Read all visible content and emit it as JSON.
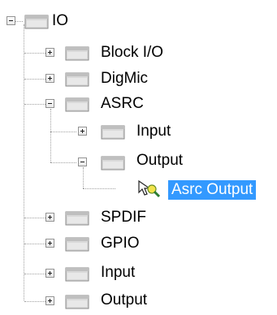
{
  "tree": {
    "nodes": [
      {
        "label": "IO",
        "expander": "minus",
        "level": 0
      },
      {
        "label": "Block I/O",
        "expander": "plus",
        "level": 1
      },
      {
        "label": "DigMic",
        "expander": "plus",
        "level": 1
      },
      {
        "label": "ASRC",
        "expander": "minus",
        "level": 1
      },
      {
        "label": "Input",
        "expander": "plus",
        "level": 2
      },
      {
        "label": "Output",
        "expander": "minus",
        "level": 2
      },
      {
        "label": "Asrc Output",
        "expander": "none",
        "level": 3,
        "selected": true
      },
      {
        "label": "SPDIF",
        "expander": "plus",
        "level": 1
      },
      {
        "label": "GPIO",
        "expander": "plus",
        "level": 1
      },
      {
        "label": "Input",
        "expander": "plus",
        "level": 1
      },
      {
        "label": "Output",
        "expander": "plus",
        "level": 1
      }
    ],
    "selection_color": "#3399ff",
    "icons": {
      "folder": "tree-node-icon",
      "leaf": "cell-tool-icon"
    }
  }
}
